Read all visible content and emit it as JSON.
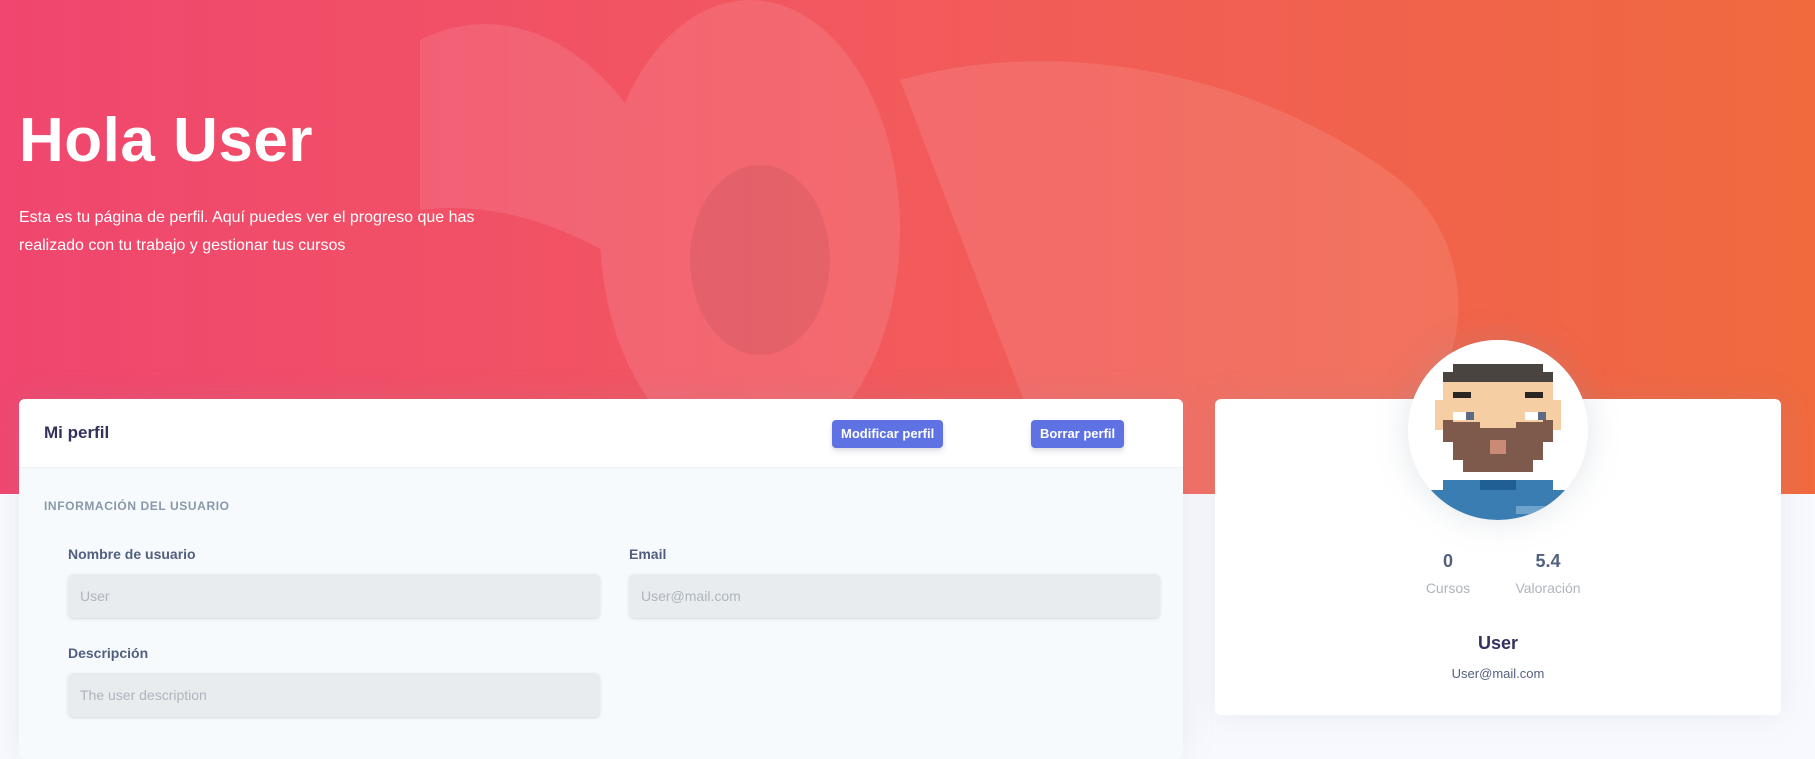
{
  "hero": {
    "title": "Hola User",
    "description": "Esta es tu página de perfil. Aquí puedes ver el progreso que has realizado con tu trabajo y gestionar tus cursos"
  },
  "profile_card": {
    "title": "Mi perfil",
    "edit_button": "Modificar perfil",
    "delete_button": "Borrar perfil",
    "section_heading": "INFORMACIÓN DEL USUARIO",
    "fields": {
      "username": {
        "label": "Nombre de usuario",
        "placeholder": "User"
      },
      "email": {
        "label": "Email",
        "placeholder": "User@mail.com"
      },
      "description": {
        "label": "Descripción",
        "placeholder": "The user description"
      }
    }
  },
  "summary_card": {
    "stats": [
      {
        "value": "0",
        "label": "Cursos"
      },
      {
        "value": "5.4",
        "label": "Valoración"
      }
    ],
    "name": "User",
    "email": "User@mail.com"
  },
  "colors": {
    "accent": "#5e72e4",
    "hero_start": "#f0466f",
    "hero_end": "#f06a3e"
  }
}
